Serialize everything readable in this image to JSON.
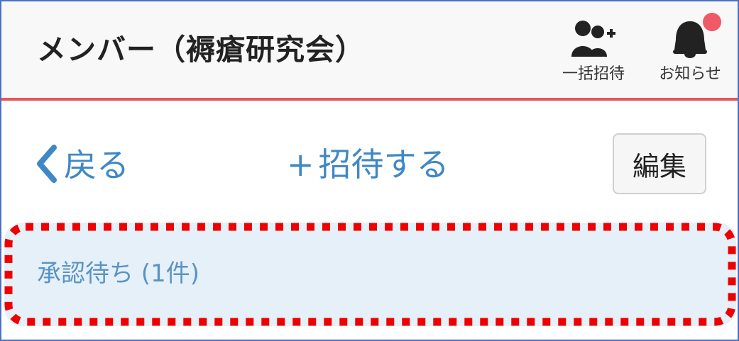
{
  "header": {
    "title": "メンバー（褥瘡研究会）",
    "invite_all_label": "一括招待",
    "notifications_label": "お知らせ"
  },
  "toolbar": {
    "back_label": "戻る",
    "invite_label": "招待する",
    "invite_plus": "+",
    "edit_label": "編集"
  },
  "pending": {
    "label": "承認待ち (1件)"
  },
  "colors": {
    "accent_blue": "#3f88c5",
    "header_divider": "#e9555f",
    "pending_bg": "#e5f0f9",
    "highlight_dots": "#ee0000",
    "badge": "#ef5a67"
  }
}
